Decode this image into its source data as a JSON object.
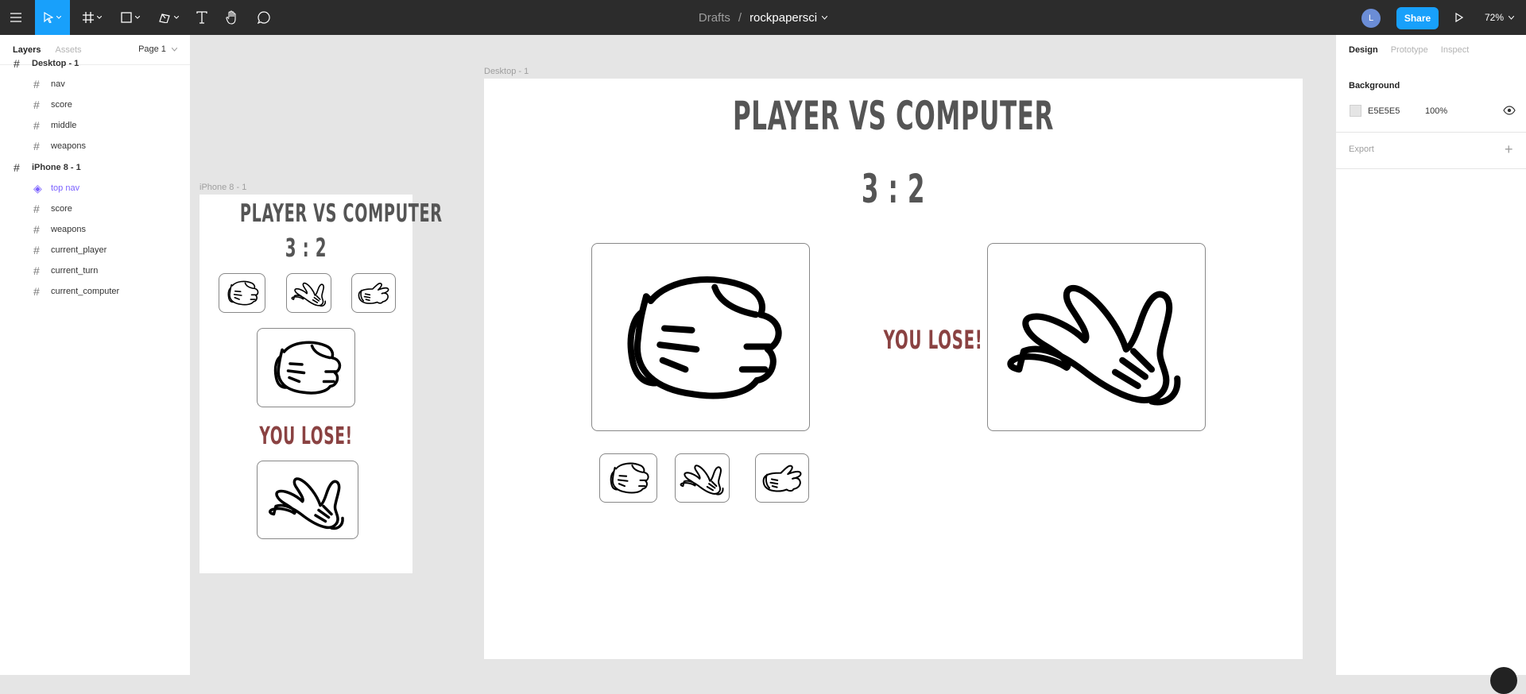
{
  "toolbar": {
    "breadcrumb_drafts": "Drafts",
    "breadcrumb_sep": "/",
    "file_name": "rockpapersci",
    "avatar_initial": "L",
    "share_label": "Share",
    "zoom_label": "72%",
    "icons": [
      "menu-icon",
      "move-tool-icon",
      "frame-tool-icon",
      "shape-tool-icon",
      "pen-tool-icon",
      "text-tool-icon",
      "hand-tool-icon",
      "comment-tool-icon",
      "present-icon"
    ]
  },
  "left_panel": {
    "tabs": [
      "Layers",
      "Assets"
    ],
    "page_label": "Page 1",
    "layers": [
      {
        "label": "Desktop - 1",
        "level": "top"
      },
      {
        "label": "nav",
        "level": "child"
      },
      {
        "label": "score",
        "level": "child"
      },
      {
        "label": "middle",
        "level": "child"
      },
      {
        "label": "weapons",
        "level": "child"
      },
      {
        "label": "iPhone 8 - 1",
        "level": "top"
      },
      {
        "label": "top nav",
        "level": "component"
      },
      {
        "label": "score",
        "level": "child"
      },
      {
        "label": "weapons",
        "level": "child"
      },
      {
        "label": "current_player",
        "level": "child"
      },
      {
        "label": "current_turn",
        "level": "child"
      },
      {
        "label": "current_computer",
        "level": "child"
      }
    ]
  },
  "right_panel": {
    "tabs": [
      "Design",
      "Prototype",
      "Inspect"
    ],
    "background_title": "Background",
    "background_hex": "E5E5E5",
    "background_opacity": "100%",
    "export_title": "Export",
    "colors": {
      "canvas": "#E5E5E5",
      "accent": "#18A0FB",
      "lose_text": "#8A4242",
      "title_text": "#555555"
    }
  },
  "canvas": {
    "desktop": {
      "frame_label": "Desktop - 1",
      "title": "PLAYER VS COMPUTER",
      "score": "3 : 2",
      "result": "YOU LOSE!"
    },
    "iphone": {
      "frame_label": "iPhone 8 - 1",
      "title": "PLAYER VS COMPUTER",
      "score": "3 : 2",
      "result": "YOU LOSE!"
    }
  }
}
